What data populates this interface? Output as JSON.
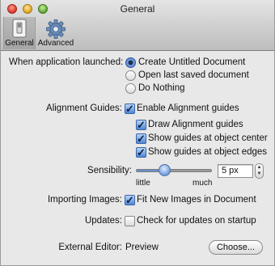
{
  "window": {
    "title": "General"
  },
  "toolbar": {
    "items": [
      {
        "label": "General",
        "icon": "switch-icon",
        "selected": true
      },
      {
        "label": "Advanced",
        "icon": "gear-icon",
        "selected": false
      }
    ]
  },
  "launch": {
    "label": "When application launched:",
    "options": [
      {
        "label": "Create Untitled Document",
        "checked": true
      },
      {
        "label": "Open last saved document",
        "checked": false
      },
      {
        "label": "Do Nothing",
        "checked": false
      }
    ]
  },
  "alignment": {
    "label": "Alignment Guides:",
    "enable": {
      "label": "Enable Alignment guides",
      "checked": true
    },
    "draw": {
      "label": "Draw Alignment guides",
      "checked": true
    },
    "center": {
      "label": "Show guides at object center",
      "checked": true
    },
    "edges": {
      "label": "Show guides at object edges",
      "checked": true
    }
  },
  "sensibility": {
    "label": "Sensibility:",
    "min_label": "little",
    "max_label": "much",
    "value": "5 px",
    "level": 0.38
  },
  "importing": {
    "label": "Importing Images:",
    "option": {
      "label": "Fit New Images in Document",
      "checked": true
    }
  },
  "updates": {
    "label": "Updates:",
    "option": {
      "label": "Check for updates on startup",
      "checked": false
    }
  },
  "editor": {
    "label": "External Editor:",
    "value": "Preview",
    "button": "Choose..."
  }
}
